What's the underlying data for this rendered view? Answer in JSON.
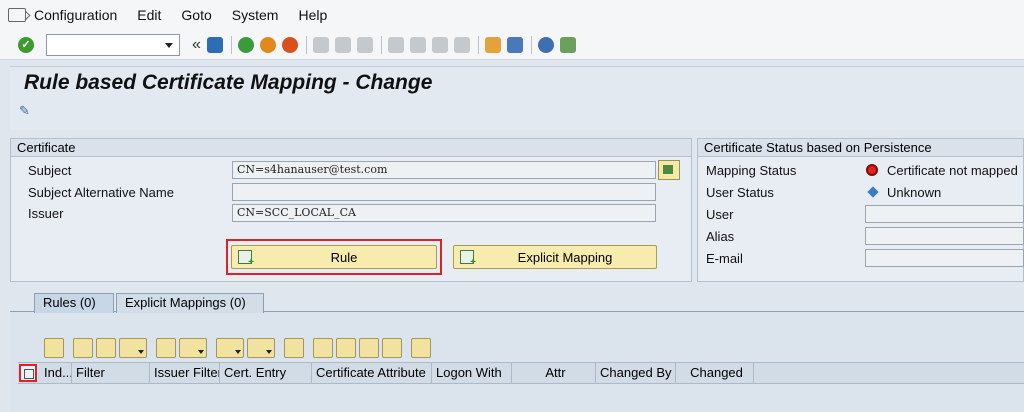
{
  "menu": {
    "items": [
      "Configuration",
      "Edit",
      "Goto",
      "System",
      "Help"
    ]
  },
  "toolbar": {
    "command_value": "",
    "icons": [
      "ok-icon",
      "save-icon",
      "back-icon",
      "exit-icon",
      "cancel-icon",
      "print-icon",
      "find-icon",
      "find-next-icon",
      "first-page-icon",
      "prev-page-icon",
      "next-page-icon",
      "last-page-icon",
      "create-session-icon",
      "shortcut-icon",
      "help-icon",
      "customize-icon"
    ]
  },
  "title": "Rule based Certificate Mapping - Change",
  "certificate": {
    "header": "Certificate",
    "subject_label": "Subject",
    "subject_value": "CN=s4hanauser@test.com",
    "san_label": "Subject Alternative Name",
    "san_value": "",
    "issuer_label": "Issuer",
    "issuer_value": "CN=SCC_LOCAL_CA",
    "rule_button": "Rule",
    "explicit_button": "Explicit Mapping"
  },
  "status": {
    "header": "Certificate Status based on Persistence",
    "mapping_status_label": "Mapping Status",
    "mapping_status_value": "Certificate not mapped",
    "user_status_label": "User Status",
    "user_status_value": "Unknown",
    "user_label": "User",
    "user_value": "",
    "alias_label": "Alias",
    "alias_value": "",
    "email_label": "E-mail",
    "email_value": ""
  },
  "tabs": [
    {
      "label": "Rules (0)",
      "active": true
    },
    {
      "label": "Explicit Mappings (0)",
      "active": false
    }
  ],
  "grid": {
    "columns": [
      "Ind...",
      "Filter",
      "Issuer Filter",
      "Cert. Entry",
      "Certificate Attribute",
      "Logon With",
      "Attr",
      "Changed By",
      "Changed"
    ]
  },
  "colors": {
    "highlight": "#d9252a",
    "button_bg": "#f7ecad",
    "status_red": "#e2231a"
  }
}
